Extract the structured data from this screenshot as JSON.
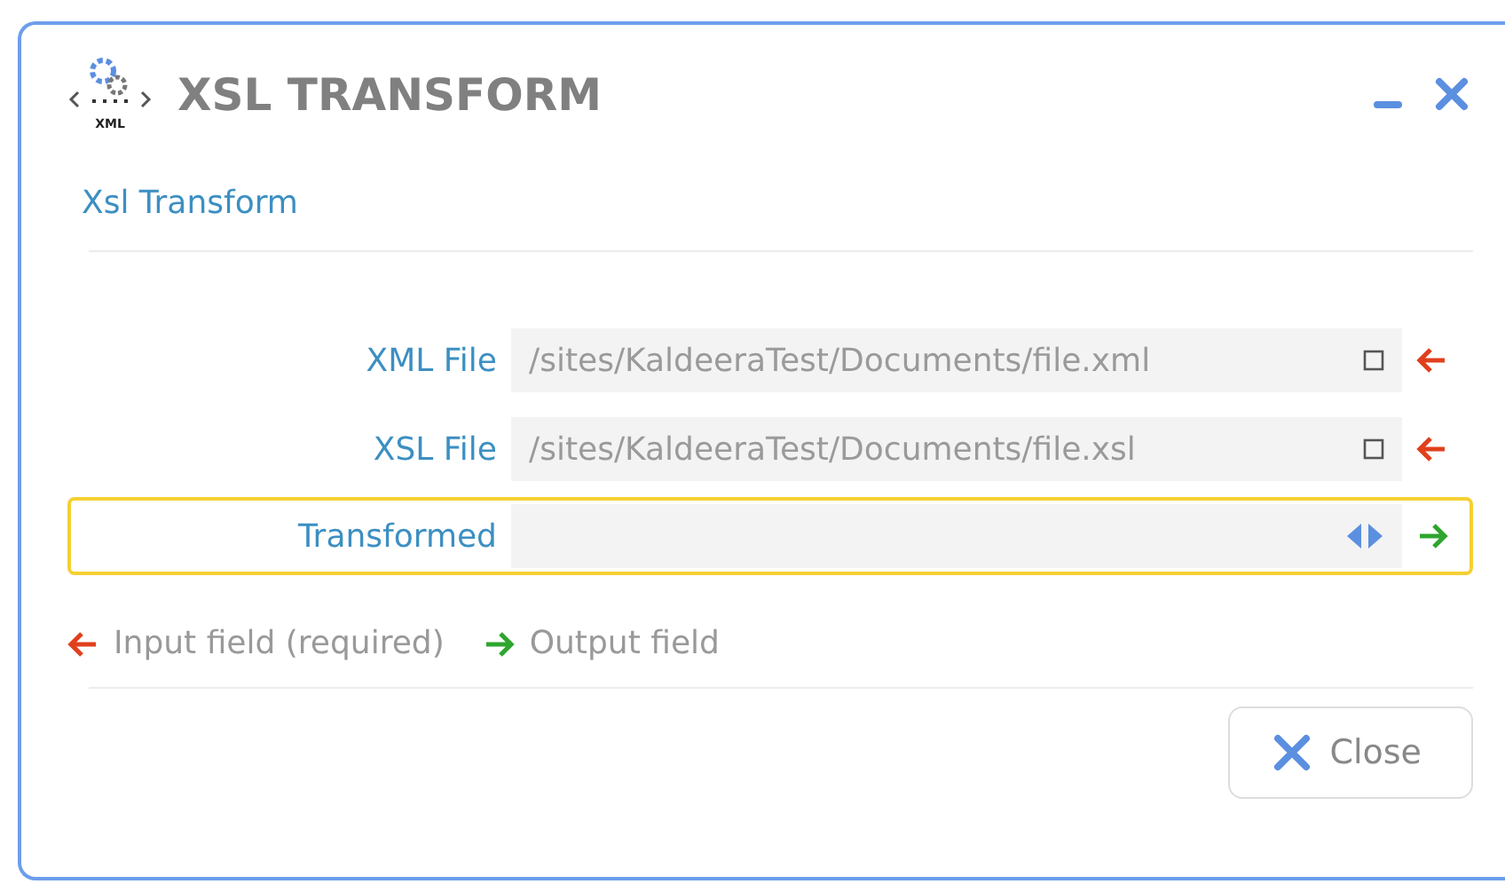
{
  "window": {
    "title": "XSL TRANSFORM",
    "icon_label": "XML"
  },
  "section": {
    "title": "Xsl Transform"
  },
  "fields": [
    {
      "label": "XML File",
      "value": "/sites/KaldeeraTest/Documents/file.xml",
      "kind": "input",
      "highlighted": false
    },
    {
      "label": "XSL File",
      "value": "/sites/KaldeeraTest/Documents/file.xsl",
      "kind": "input",
      "highlighted": false
    },
    {
      "label": "Transformed",
      "kind": "output",
      "highlighted": true
    }
  ],
  "legend": [
    {
      "kind": "input",
      "text": "Input field (required)"
    },
    {
      "kind": "output",
      "text": "Output field"
    }
  ],
  "buttons": [
    {
      "label": "Close"
    }
  ]
}
